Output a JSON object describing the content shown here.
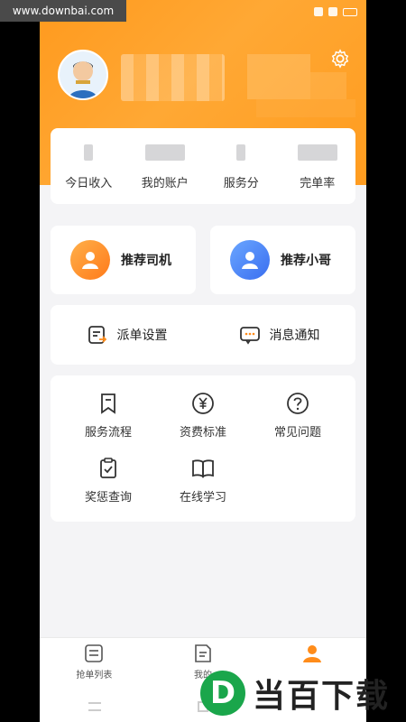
{
  "watermark_top": "www.downbai.com",
  "stats": [
    {
      "label": "今日收入"
    },
    {
      "label": "我的账户"
    },
    {
      "label": "服务分"
    },
    {
      "label": "完单率"
    }
  ],
  "recommend": [
    {
      "label": "推荐司机",
      "icon": "driver-icon"
    },
    {
      "label": "推荐小哥",
      "icon": "courier-icon"
    }
  ],
  "settings": [
    {
      "label": "派单设置",
      "icon": "dispatch-icon"
    },
    {
      "label": "消息通知",
      "icon": "message-icon"
    }
  ],
  "grid": [
    {
      "label": "服务流程",
      "icon": "bookmark-icon"
    },
    {
      "label": "资费标准",
      "icon": "yuan-icon"
    },
    {
      "label": "常见问题",
      "icon": "question-icon"
    },
    {
      "label": "奖惩查询",
      "icon": "clipboard-check-icon"
    },
    {
      "label": "在线学习",
      "icon": "book-icon"
    }
  ],
  "tabs": [
    {
      "label": "抢单列表",
      "icon": "list-icon"
    },
    {
      "label": "我的",
      "icon": "doc-icon"
    },
    {
      "label": "",
      "icon": "person-icon"
    }
  ],
  "logo": {
    "letter": "D",
    "text": "当百下载"
  },
  "colors": {
    "accent": "#ff9a1e",
    "background": "#f4f4f6",
    "logo_green": "#1aa64b"
  }
}
